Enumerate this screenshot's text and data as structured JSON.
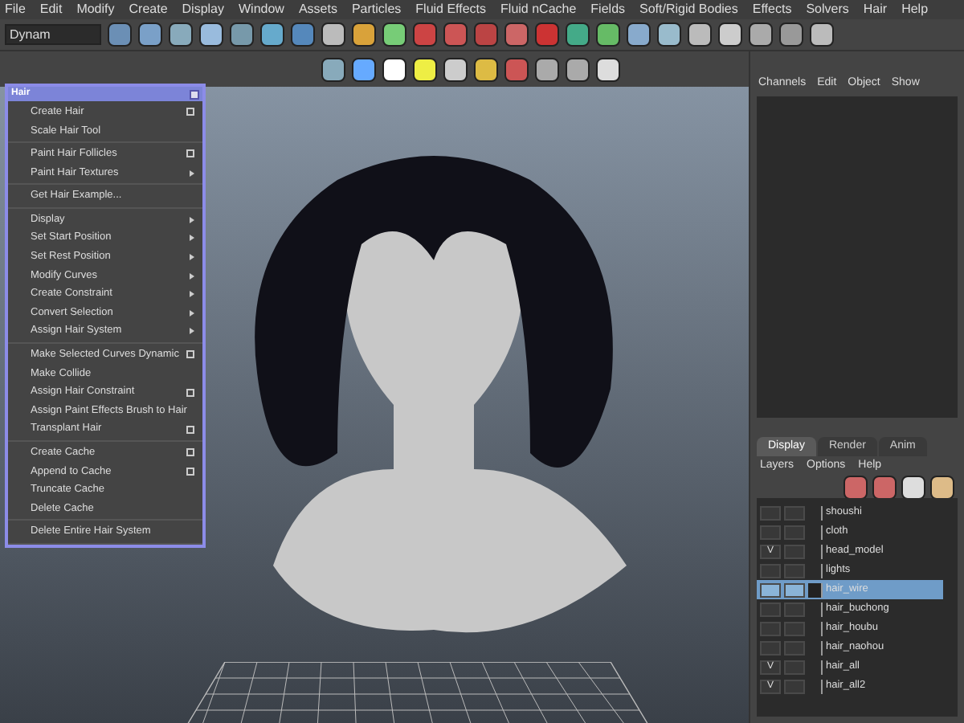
{
  "menu_bar": [
    "File",
    "Edit",
    "Modify",
    "Create",
    "Display",
    "Window",
    "Assets",
    "Particles",
    "Fluid Effects",
    "Fluid nCache",
    "Fields",
    "Soft/Rigid Bodies",
    "Effects",
    "Solvers",
    "Hair",
    "Help"
  ],
  "mode_dropdown": {
    "value": "Dynam"
  },
  "hair_menu": {
    "title": "Hair",
    "sections": [
      [
        {
          "label": "Create Hair",
          "option_box": true,
          "submenu": false
        },
        {
          "label": "Scale Hair Tool",
          "option_box": false,
          "submenu": false
        }
      ],
      [
        {
          "label": "Paint Hair Follicles",
          "option_box": true,
          "submenu": false
        },
        {
          "label": "Paint Hair Textures",
          "option_box": false,
          "submenu": true
        }
      ],
      [
        {
          "label": "Get Hair Example...",
          "option_box": false,
          "submenu": false
        }
      ],
      [
        {
          "label": "Display",
          "option_box": false,
          "submenu": true
        },
        {
          "label": "Set Start Position",
          "option_box": false,
          "submenu": true
        },
        {
          "label": "Set Rest Position",
          "option_box": false,
          "submenu": true
        },
        {
          "label": "Modify Curves",
          "option_box": false,
          "submenu": true
        },
        {
          "label": "Create Constraint",
          "option_box": false,
          "submenu": true
        },
        {
          "label": "Convert Selection",
          "option_box": false,
          "submenu": true
        },
        {
          "label": "Assign Hair System",
          "option_box": false,
          "submenu": true
        }
      ],
      [
        {
          "label": "Make Selected Curves Dynamic",
          "option_box": true,
          "submenu": false
        },
        {
          "label": "Make Collide",
          "option_box": false,
          "submenu": false
        },
        {
          "label": "Assign Hair Constraint",
          "option_box": true,
          "submenu": false
        },
        {
          "label": "Assign Paint Effects Brush to Hair",
          "option_box": false,
          "submenu": false
        },
        {
          "label": "Transplant Hair",
          "option_box": true,
          "submenu": false
        }
      ],
      [
        {
          "label": "Create Cache",
          "option_box": true,
          "submenu": false
        },
        {
          "label": "Append to Cache",
          "option_box": true,
          "submenu": false
        },
        {
          "label": "Truncate Cache",
          "option_box": false,
          "submenu": false
        },
        {
          "label": "Delete Cache",
          "option_box": false,
          "submenu": false
        }
      ],
      [
        {
          "label": "Delete Entire Hair System",
          "option_box": false,
          "submenu": false
        }
      ]
    ]
  },
  "channel_box": {
    "menus": [
      "Channels",
      "Edit",
      "Object",
      "Show"
    ]
  },
  "layer_editor": {
    "tabs": [
      {
        "label": "Display",
        "selected": true
      },
      {
        "label": "Render",
        "selected": false
      },
      {
        "label": "Anim",
        "selected": false
      }
    ],
    "menus": [
      "Layers",
      "Options",
      "Help"
    ],
    "layers": [
      {
        "name": "shoushi",
        "selected": false
      },
      {
        "name": "cloth",
        "selected": false
      },
      {
        "name": "head_model",
        "visible_mark": "V",
        "selected": false
      },
      {
        "name": "lights",
        "selected": false
      },
      {
        "name": "hair_wire",
        "selected": true
      },
      {
        "name": "hair_buchong",
        "selected": false
      },
      {
        "name": "hair_houbu",
        "selected": false
      },
      {
        "name": "hair_naohou",
        "selected": false
      },
      {
        "name": "hair_all",
        "visible_mark": "V",
        "selected": false
      },
      {
        "name": "hair_all2",
        "visible_mark": "V",
        "selected": false
      }
    ]
  }
}
